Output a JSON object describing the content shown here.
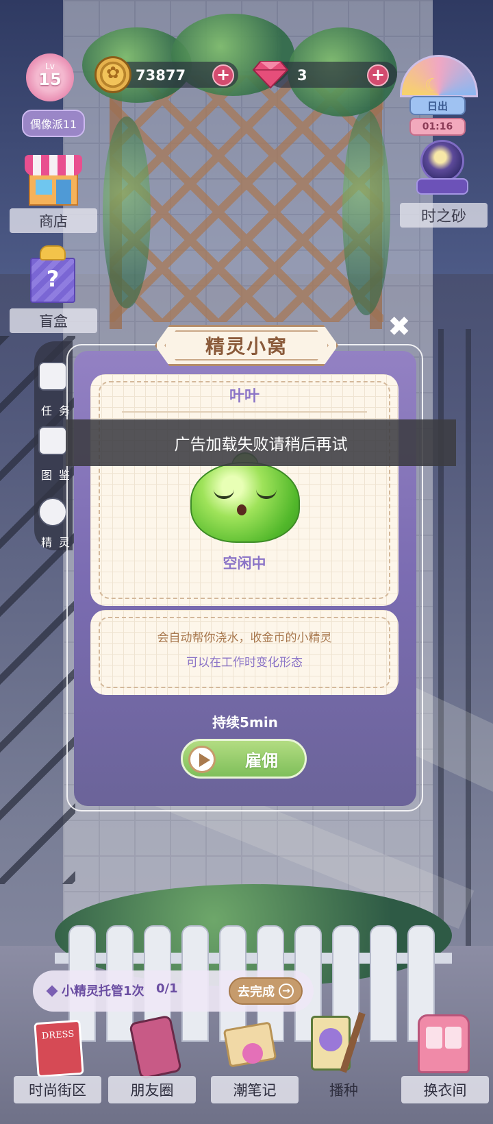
{
  "hud": {
    "level_small": "Lv",
    "level": "15",
    "player_name": "偶像派11",
    "coins": "73877",
    "gems": "3",
    "add_symbol": "+",
    "daytime_label": "日出",
    "daytime_timer": "01:16"
  },
  "side_menu": {
    "shop": "商店",
    "blind_box": "盲盒",
    "time_sand": "时之砂"
  },
  "side_tabs": [
    {
      "label": "任务",
      "icon": "clipboard-icon"
    },
    {
      "label": "图鉴",
      "icon": "book-icon"
    },
    {
      "label": "精灵",
      "icon": "sprite-icon"
    }
  ],
  "dialog": {
    "title": "精灵小窝",
    "close_symbol": "✖",
    "sprite_name": "叶叶",
    "status": "空闲中",
    "desc_line1": "会自动帮你浇水，收金币的小精灵",
    "desc_line2": "可以在工作时变化形态",
    "duration": "持续5min",
    "hire_button": "雇佣"
  },
  "toast": {
    "message": "广告加载失败请稍后再试"
  },
  "task": {
    "text": "小精灵托管1次",
    "progress": "0/1",
    "button": "去完成",
    "button_arrow": "→"
  },
  "bottom_nav": [
    {
      "label": "时尚街区",
      "icon": "dress-book-icon"
    },
    {
      "label": "朋友圈",
      "icon": "phone-icon"
    },
    {
      "label": "潮笔记",
      "icon": "notebook-icon"
    },
    {
      "label": "播种",
      "icon": "seed-bag-icon"
    },
    {
      "label": "换衣间",
      "icon": "wardrobe-icon"
    }
  ],
  "dress_book_text": "DRESS",
  "colors": {
    "dialog_purple": "#7b6cb2",
    "hire_green": "#7fbf5a",
    "accent_pink": "#d34c6f"
  }
}
